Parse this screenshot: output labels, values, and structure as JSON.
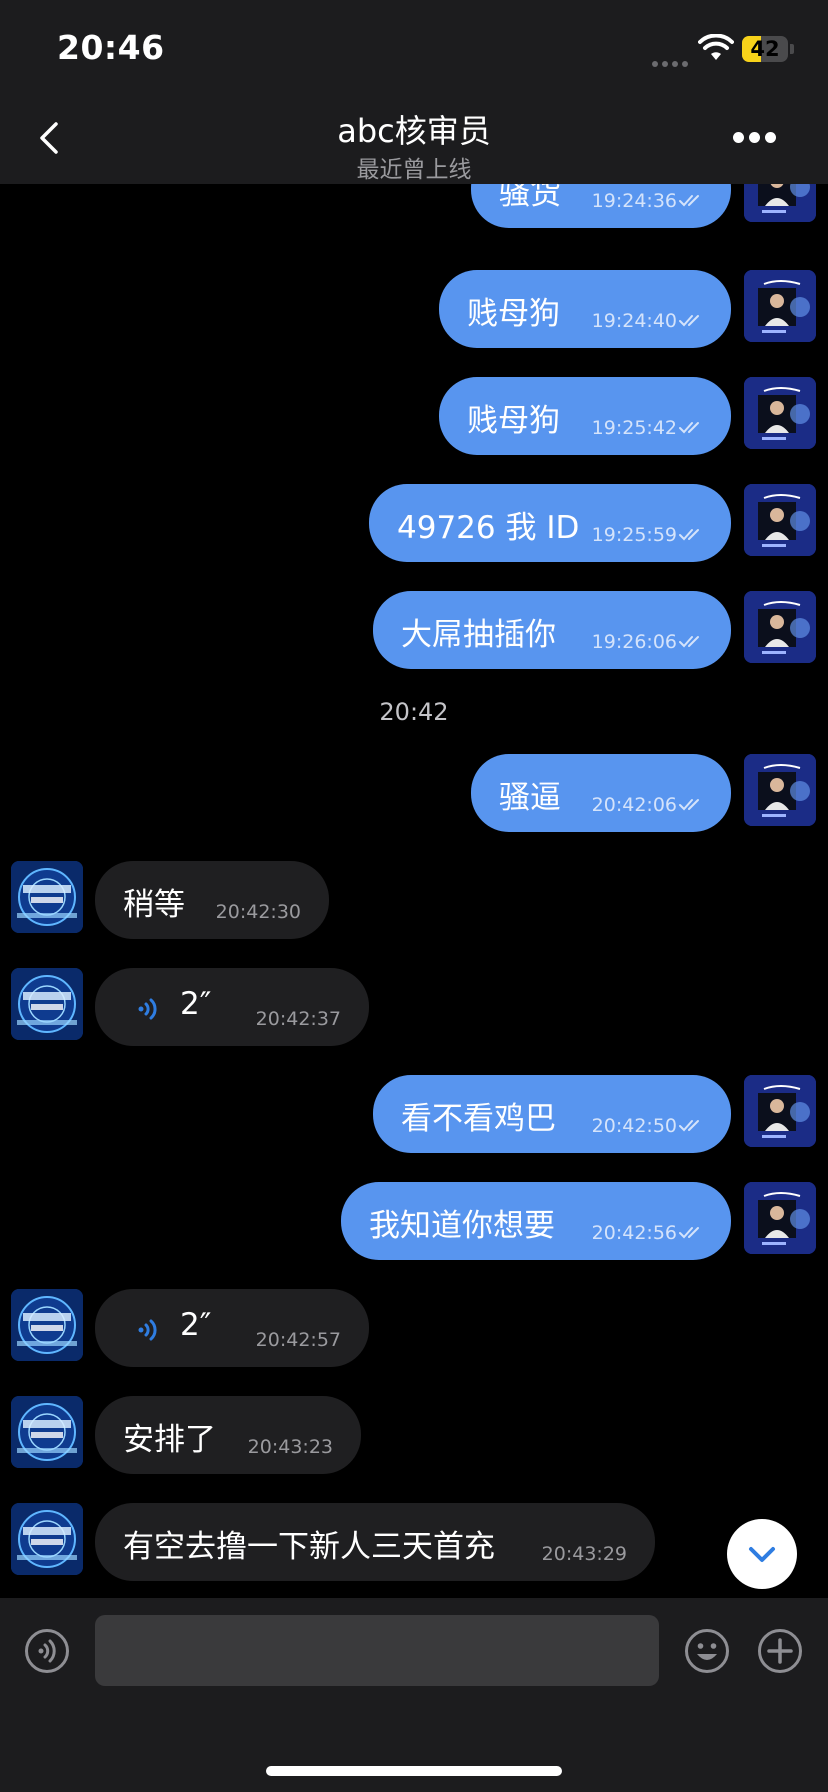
{
  "status_bar": {
    "time": "20:46",
    "battery": "42",
    "battery_level": 0.42
  },
  "header": {
    "title": "abc核审员",
    "subtitle": "最近曾上线",
    "icons": {
      "back": "chevron-left-icon",
      "more": "ellipsis-icon"
    }
  },
  "messages": [
    {
      "dir": "out",
      "text": "骚货",
      "time": "19:24:36",
      "status": "read"
    },
    {
      "dir": "out",
      "text": "贱母狗",
      "time": "19:24:40",
      "status": "read"
    },
    {
      "dir": "out",
      "text": "贱母狗",
      "time": "19:25:42",
      "status": "read"
    },
    {
      "dir": "out",
      "text": "49726 我 ID",
      "time": "19:25:59",
      "status": "read"
    },
    {
      "dir": "out",
      "text": "大屌抽插你",
      "time": "19:26:06",
      "status": "read"
    },
    {
      "type": "date",
      "text": "20:42"
    },
    {
      "dir": "out",
      "text": "骚逼",
      "time": "20:42:06",
      "status": "read"
    },
    {
      "dir": "in",
      "text": "稍等",
      "time": "20:42:30"
    },
    {
      "dir": "in",
      "kind": "voice",
      "duration": "2″",
      "time": "20:42:37"
    },
    {
      "dir": "out",
      "text": "看不看鸡巴",
      "time": "20:42:50",
      "status": "read"
    },
    {
      "dir": "out",
      "text": "我知道你想要",
      "time": "20:42:56",
      "status": "read"
    },
    {
      "dir": "in",
      "kind": "voice",
      "duration": "2″",
      "time": "20:42:57"
    },
    {
      "dir": "in",
      "text": "安排了",
      "time": "20:43:23"
    },
    {
      "dir": "in",
      "text": "有空去撸一下新人三天首充",
      "time": "20:43:29"
    }
  ],
  "input": {
    "value": "",
    "placeholder": ""
  },
  "colors": {
    "outgoing_bubble": "#5895ef",
    "incoming_bubble": "#1f1f21",
    "bar_background": "#1c1c1e",
    "battery_accent": "#f7d21a"
  }
}
